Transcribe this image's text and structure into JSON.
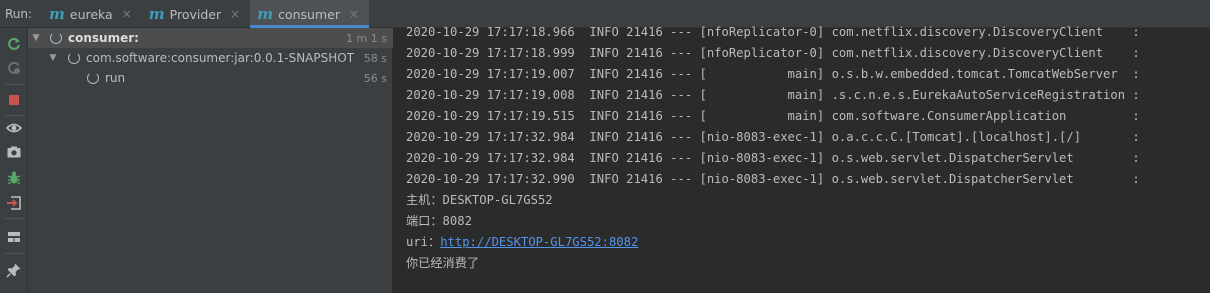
{
  "run_label": "Run:",
  "tabs": [
    {
      "icon": "m",
      "label": "eureka",
      "close": "×"
    },
    {
      "icon": "m",
      "label": "Provider",
      "close": "×"
    },
    {
      "icon": "m",
      "label": "consumer",
      "close": "×"
    }
  ],
  "active_tab": 2,
  "toolbar_icons": [
    "rerun-icon",
    "rerun-failed-icon",
    "stop-icon",
    "view-icon",
    "screenshot-icon",
    "debug-icon",
    "exit-icon",
    "layout-icon",
    "pin-icon"
  ],
  "colors": {
    "link": "#5394ec",
    "tab_accent": "#4a88c7",
    "rerun": "#59a869",
    "stop": "#c75450"
  },
  "tree": [
    {
      "label": "consumer:",
      "time": "1 m 1 s",
      "bold": true,
      "arrow": "▼"
    },
    {
      "label": "com.software:consumer:jar:0.0.1-SNAPSHOT",
      "time": "58 s",
      "bold": false,
      "arrow": "▼"
    },
    {
      "label": "run",
      "time": "56 s",
      "bold": false,
      "arrow": ""
    }
  ],
  "console": [
    "2020-10-29 17:17:18.966  INFO 21416 --- [nfoReplicator-0] com.netflix.discovery.DiscoveryClient    :",
    "2020-10-29 17:17:18.999  INFO 21416 --- [nfoReplicator-0] com.netflix.discovery.DiscoveryClient    :",
    "2020-10-29 17:17:19.007  INFO 21416 --- [           main] o.s.b.w.embedded.tomcat.TomcatWebServer  :",
    "2020-10-29 17:17:19.008  INFO 21416 --- [           main] .s.c.n.e.s.EurekaAutoServiceRegistration :",
    "2020-10-29 17:17:19.515  INFO 21416 --- [           main] com.software.ConsumerApplication         :",
    "2020-10-29 17:17:32.984  INFO 21416 --- [nio-8083-exec-1] o.a.c.c.C.[Tomcat].[localhost].[/]       :",
    "2020-10-29 17:17:32.984  INFO 21416 --- [nio-8083-exec-1] o.s.web.servlet.DispatcherServlet        :",
    "2020-10-29 17:17:32.990  INFO 21416 --- [nio-8083-exec-1] o.s.web.servlet.DispatcherServlet        :"
  ],
  "output": {
    "host": "主机：DESKTOP-GL7GS52",
    "port": "端口：8082",
    "uri_prefix": "uri：",
    "uri_link": "http://DESKTOP-GL7GS52:8082",
    "consumed": "你已经消费了"
  }
}
